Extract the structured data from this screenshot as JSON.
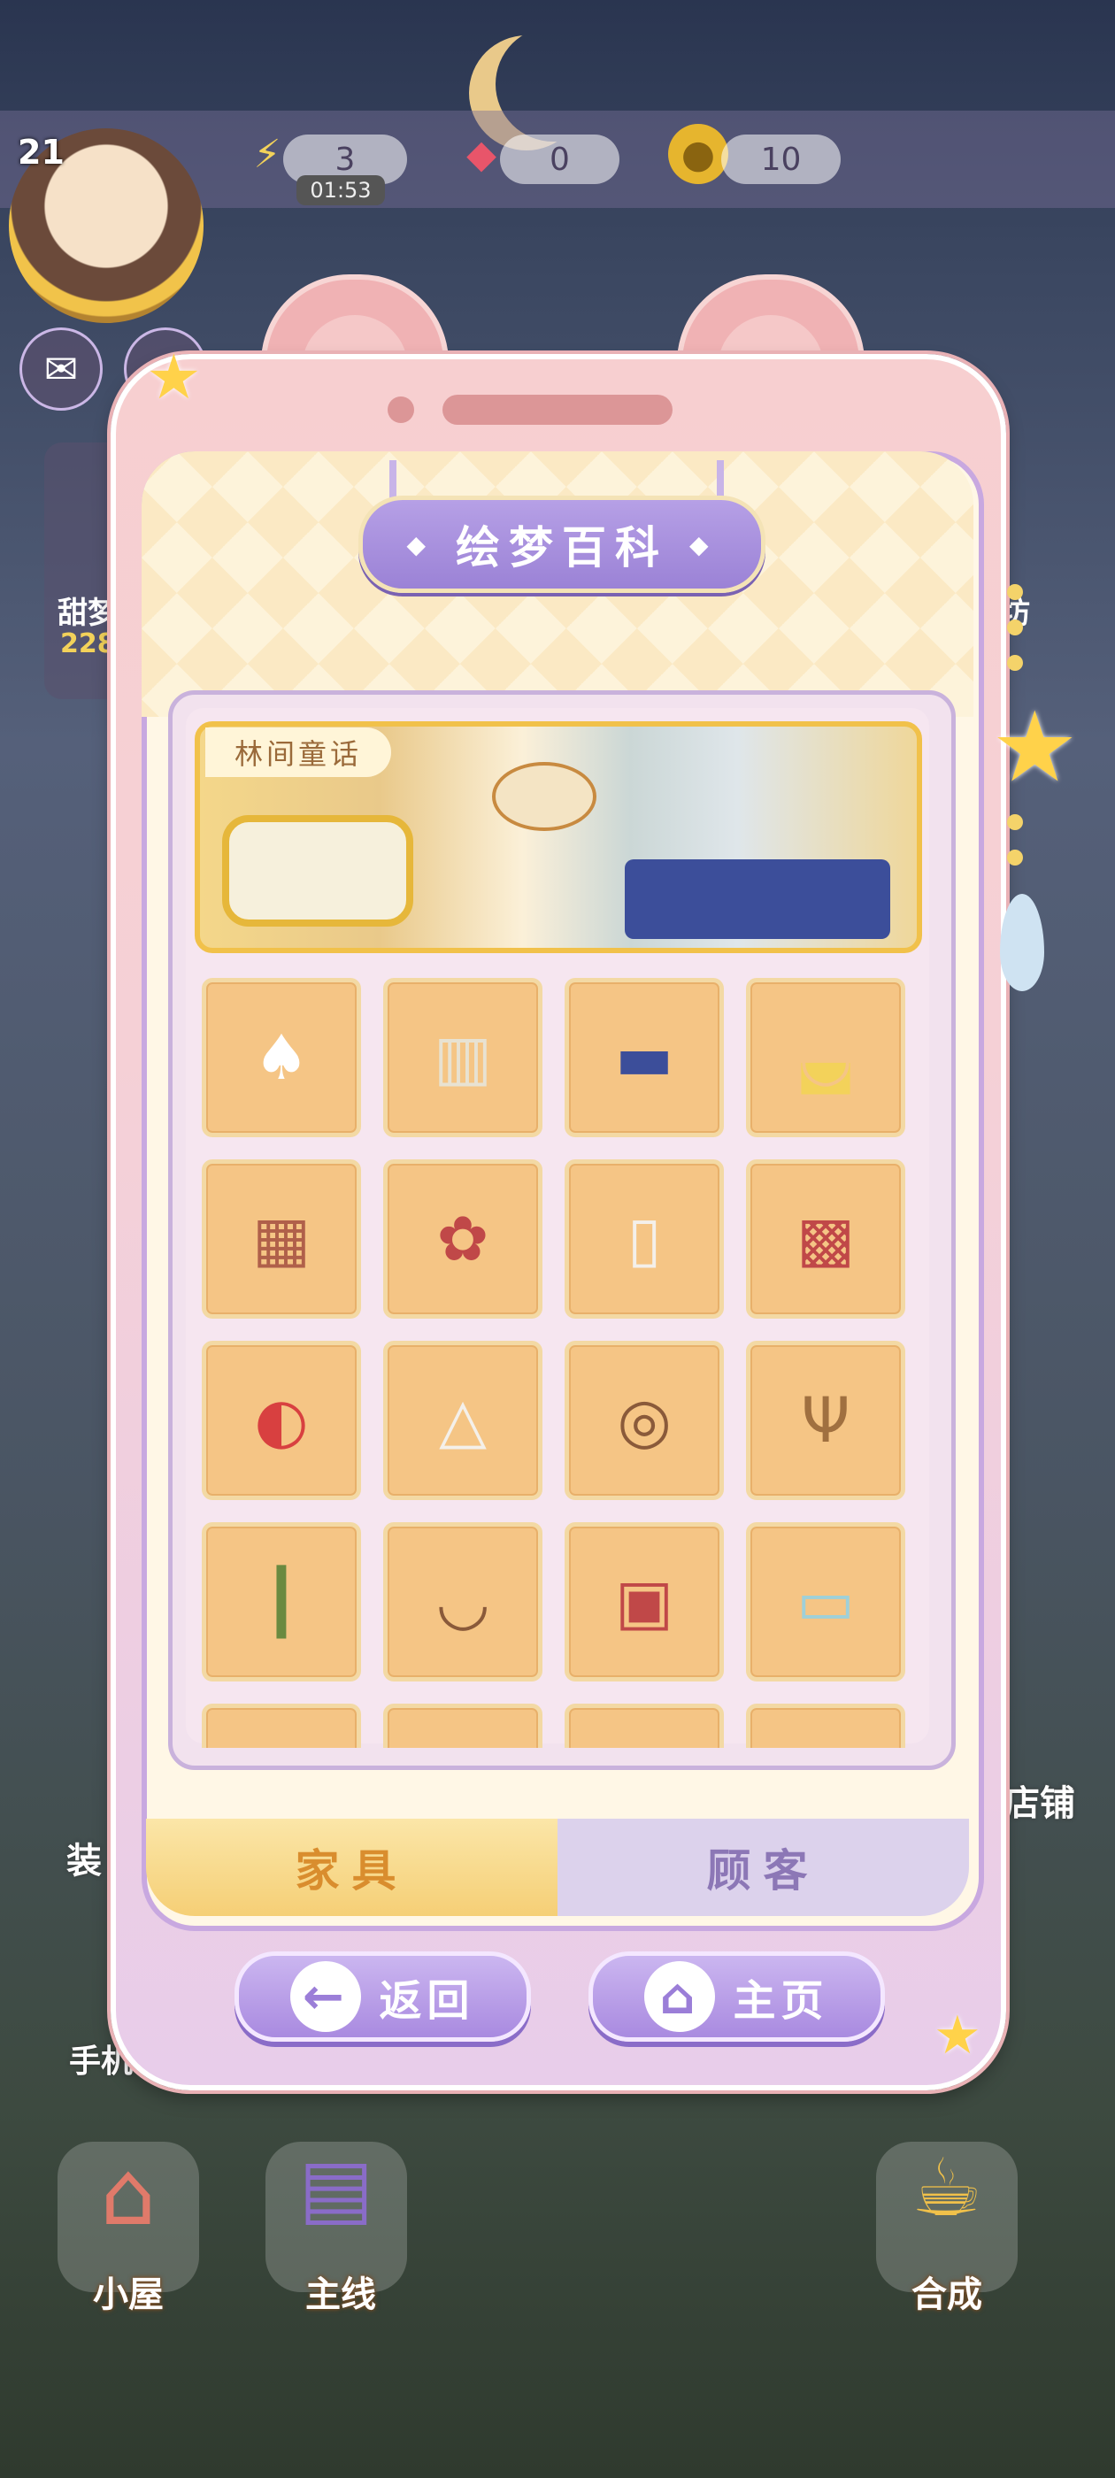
{
  "hud": {
    "level": "21",
    "energy": "3",
    "energy_timer": "01:53",
    "gems": "0",
    "coins": "10"
  },
  "sidebar_left": {
    "sweets_label": "甜梦",
    "sweets_count": "228",
    "decor_label": "装",
    "phone_label": "手机"
  },
  "sidebar_right": {
    "workshop_label": "坊",
    "shop_label": "店铺"
  },
  "bottom_nav": {
    "cottage": "小屋",
    "main_story": "主线",
    "merge": "合成"
  },
  "encyclopedia": {
    "title": "绘梦百科",
    "collection_name": "林间童话",
    "items": [
      {
        "icon": "mushroom-lamp-icon"
      },
      {
        "icon": "window-curtain-icon"
      },
      {
        "icon": "bed-icon"
      },
      {
        "icon": "sofa-icon"
      },
      {
        "icon": "fireplace-icon"
      },
      {
        "icon": "mushroom-stool-set-icon"
      },
      {
        "icon": "arched-mirror-icon"
      },
      {
        "icon": "market-stall-icon"
      },
      {
        "icon": "apple-rug-icon"
      },
      {
        "icon": "easel-icon"
      },
      {
        "icon": "vanity-table-icon"
      },
      {
        "icon": "antler-hook-icon"
      },
      {
        "icon": "vine-coat-rack-icon"
      },
      {
        "icon": "bunny-basket-icon"
      },
      {
        "icon": "picture-frames-icon"
      },
      {
        "icon": "terrarium-icon"
      },
      {
        "icon": "partial-item-icon"
      },
      {
        "icon": "partial-item-icon"
      },
      {
        "icon": "partial-item-icon"
      },
      {
        "icon": "partial-item-icon"
      }
    ],
    "tabs": [
      {
        "label": "家具",
        "active": true
      },
      {
        "label": "顾客",
        "active": false
      }
    ],
    "back_label": "返回",
    "home_label": "主页"
  },
  "colors": {
    "frame_pink": "#f0b2b4",
    "accent_purple": "#9b82d6",
    "tile_orange": "#f5c585",
    "active_tab": "#f5cf76"
  }
}
